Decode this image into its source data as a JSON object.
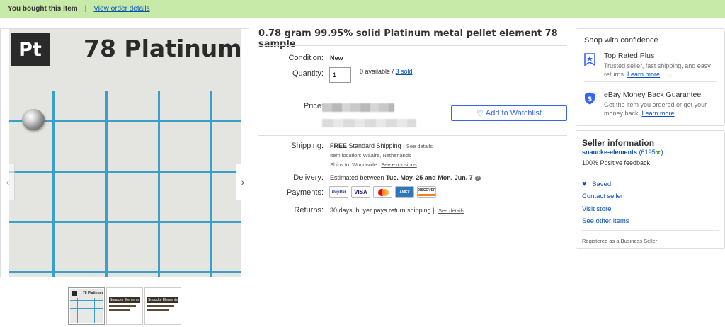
{
  "banner": {
    "bought_text": "You bought this item",
    "separator": "|",
    "order_link": "View order details"
  },
  "gallery": {
    "photo_tag": "Pt",
    "photo_label": "78  Platinum",
    "thumb1_label": "78  Platinum",
    "thumb2_label": "Snaucke Elements",
    "thumb3_label": "Snaucke Elements",
    "prev_icon": "chevron-left-icon",
    "next_icon": "chevron-right-icon"
  },
  "listing": {
    "title": "0.78 gram 99.95% solid Platinum metal pellet element 78 sample",
    "condition_label": "Condition:",
    "condition_value": "New",
    "quantity_label": "Quantity:",
    "quantity_value": "1",
    "available_text": "0 available / ",
    "sold_link": "3 sold",
    "price_label": "Price:",
    "watchlist_button": "Add to Watchlist",
    "shipping_label": "Shipping:",
    "shipping_free": "FREE",
    "shipping_method": " Standard Shipping | ",
    "shipping_details_link": "See details",
    "item_location": "Item location:  Waalre, Netherlands",
    "ships_to": "Ships to:  Worldwide",
    "exclusions_link": "See exclusions",
    "delivery_label": "Delivery:",
    "delivery_prefix": "Estimated between ",
    "delivery_dates": "Tue. May. 25 and Mon. Jun. 7",
    "payments_label": "Payments:",
    "payment_methods": [
      "PayPal",
      "VISA",
      "MasterCard",
      "AMERICAN EXPRESS",
      "DISCOVER"
    ],
    "returns_label": "Returns:",
    "returns_text": "30 days, buyer pays return shipping | ",
    "returns_details_link": "See details"
  },
  "confidence": {
    "title": "Shop with confidence",
    "top_rated_title": "Top Rated Plus",
    "top_rated_desc": "Trusted seller, fast shipping, and easy returns. ",
    "top_rated_link": "Learn more",
    "mbg_title": "eBay Money Back Guarantee",
    "mbg_desc": "Get the item you ordered or get your money back. ",
    "mbg_link": "Learn more"
  },
  "seller": {
    "title": "Seller information",
    "name": "snaucke-elements",
    "score": "(6195",
    "score_end": ")",
    "feedback": "100% Positive feedback",
    "saved": "Saved",
    "contact": "Contact seller",
    "visit": "Visit store",
    "other_items": "See other items",
    "registered": "Registered as a Business Seller"
  },
  "colors": {
    "banner_bg": "#c7eaa8",
    "link": "#0654ba",
    "accent": "#3665f3",
    "grid_blue": "#3aa0c8"
  }
}
